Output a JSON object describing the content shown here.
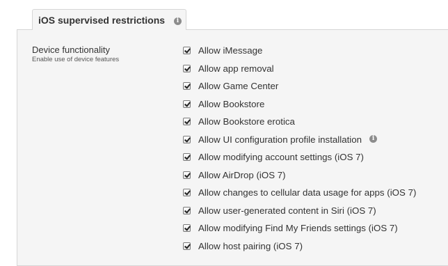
{
  "tab": {
    "title": "iOS supervised restrictions",
    "info_icon": "info-icon"
  },
  "section": {
    "title": "Device functionality",
    "description": "Enable use of device features"
  },
  "options": [
    {
      "label": "Allow iMessage",
      "checked": true
    },
    {
      "label": "Allow app removal",
      "checked": true
    },
    {
      "label": "Allow Game Center",
      "checked": true
    },
    {
      "label": "Allow Bookstore",
      "checked": true
    },
    {
      "label": "Allow Bookstore erotica",
      "checked": true
    },
    {
      "label": "Allow UI configuration profile installation",
      "checked": true,
      "info_icon": "info-icon"
    },
    {
      "label": "Allow modifying account settings (iOS 7)",
      "checked": true
    },
    {
      "label": "Allow AirDrop (iOS 7)",
      "checked": true
    },
    {
      "label": "Allow changes to cellular data usage for apps (iOS 7)",
      "checked": true
    },
    {
      "label": "Allow user-generated content in Siri (iOS 7)",
      "checked": true
    },
    {
      "label": "Allow modifying Find My Friends settings (iOS 7)",
      "checked": true
    },
    {
      "label": "Allow host pairing (iOS 7)",
      "checked": true
    }
  ],
  "colors": {
    "panel_background": "#f5f5f5",
    "border": "#d6d6d6",
    "text": "#333333",
    "info_icon": "#8c8c8c"
  }
}
